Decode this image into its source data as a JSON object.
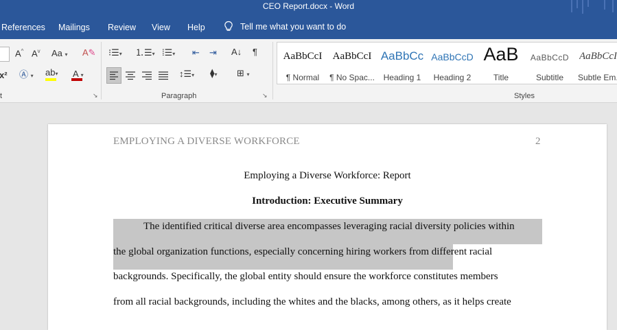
{
  "window": {
    "title": "CEO Report.docx  -  Word"
  },
  "tabs": [
    "References",
    "Mailings",
    "Review",
    "View",
    "Help"
  ],
  "tell_me": {
    "text": "Tell me what you want to do"
  },
  "ribbon": {
    "paragraph_label": "Paragraph",
    "styles_label": "Styles",
    "styles": [
      {
        "sample": "AaBbCcI",
        "name": "¶ Normal"
      },
      {
        "sample": "AaBbCcI",
        "name": "¶ No Spac..."
      },
      {
        "sample": "AaBbCc",
        "name": "Heading 1"
      },
      {
        "sample": "AaBbCcD",
        "name": "Heading 2"
      },
      {
        "sample": "AaB",
        "name": "Title"
      },
      {
        "sample": "AaBbCcD",
        "name": "Subtitle"
      },
      {
        "sample": "AaBbCcI",
        "name": "Subtle Em..."
      }
    ],
    "accent_color": "#2b579a",
    "highlight_color": "#ffff00",
    "font_color": "#c00000"
  },
  "document": {
    "running_head": "EMPLOYING A DIVERSE WORKFORCE",
    "page_number": "2",
    "title": "Employing a Diverse Workforce: Report",
    "section_heading": "Introduction: Executive Summary",
    "lines": [
      "The identified critical diverse area encompasses leveraging racial diversity policies within",
      "the global organization functions, especially concerning hiring workers from different racial",
      "backgrounds. Specifically, the global entity should ensure the workforce constitutes members",
      "from all racial backgrounds, including the whites and the blacks, among others, as it helps create"
    ]
  }
}
